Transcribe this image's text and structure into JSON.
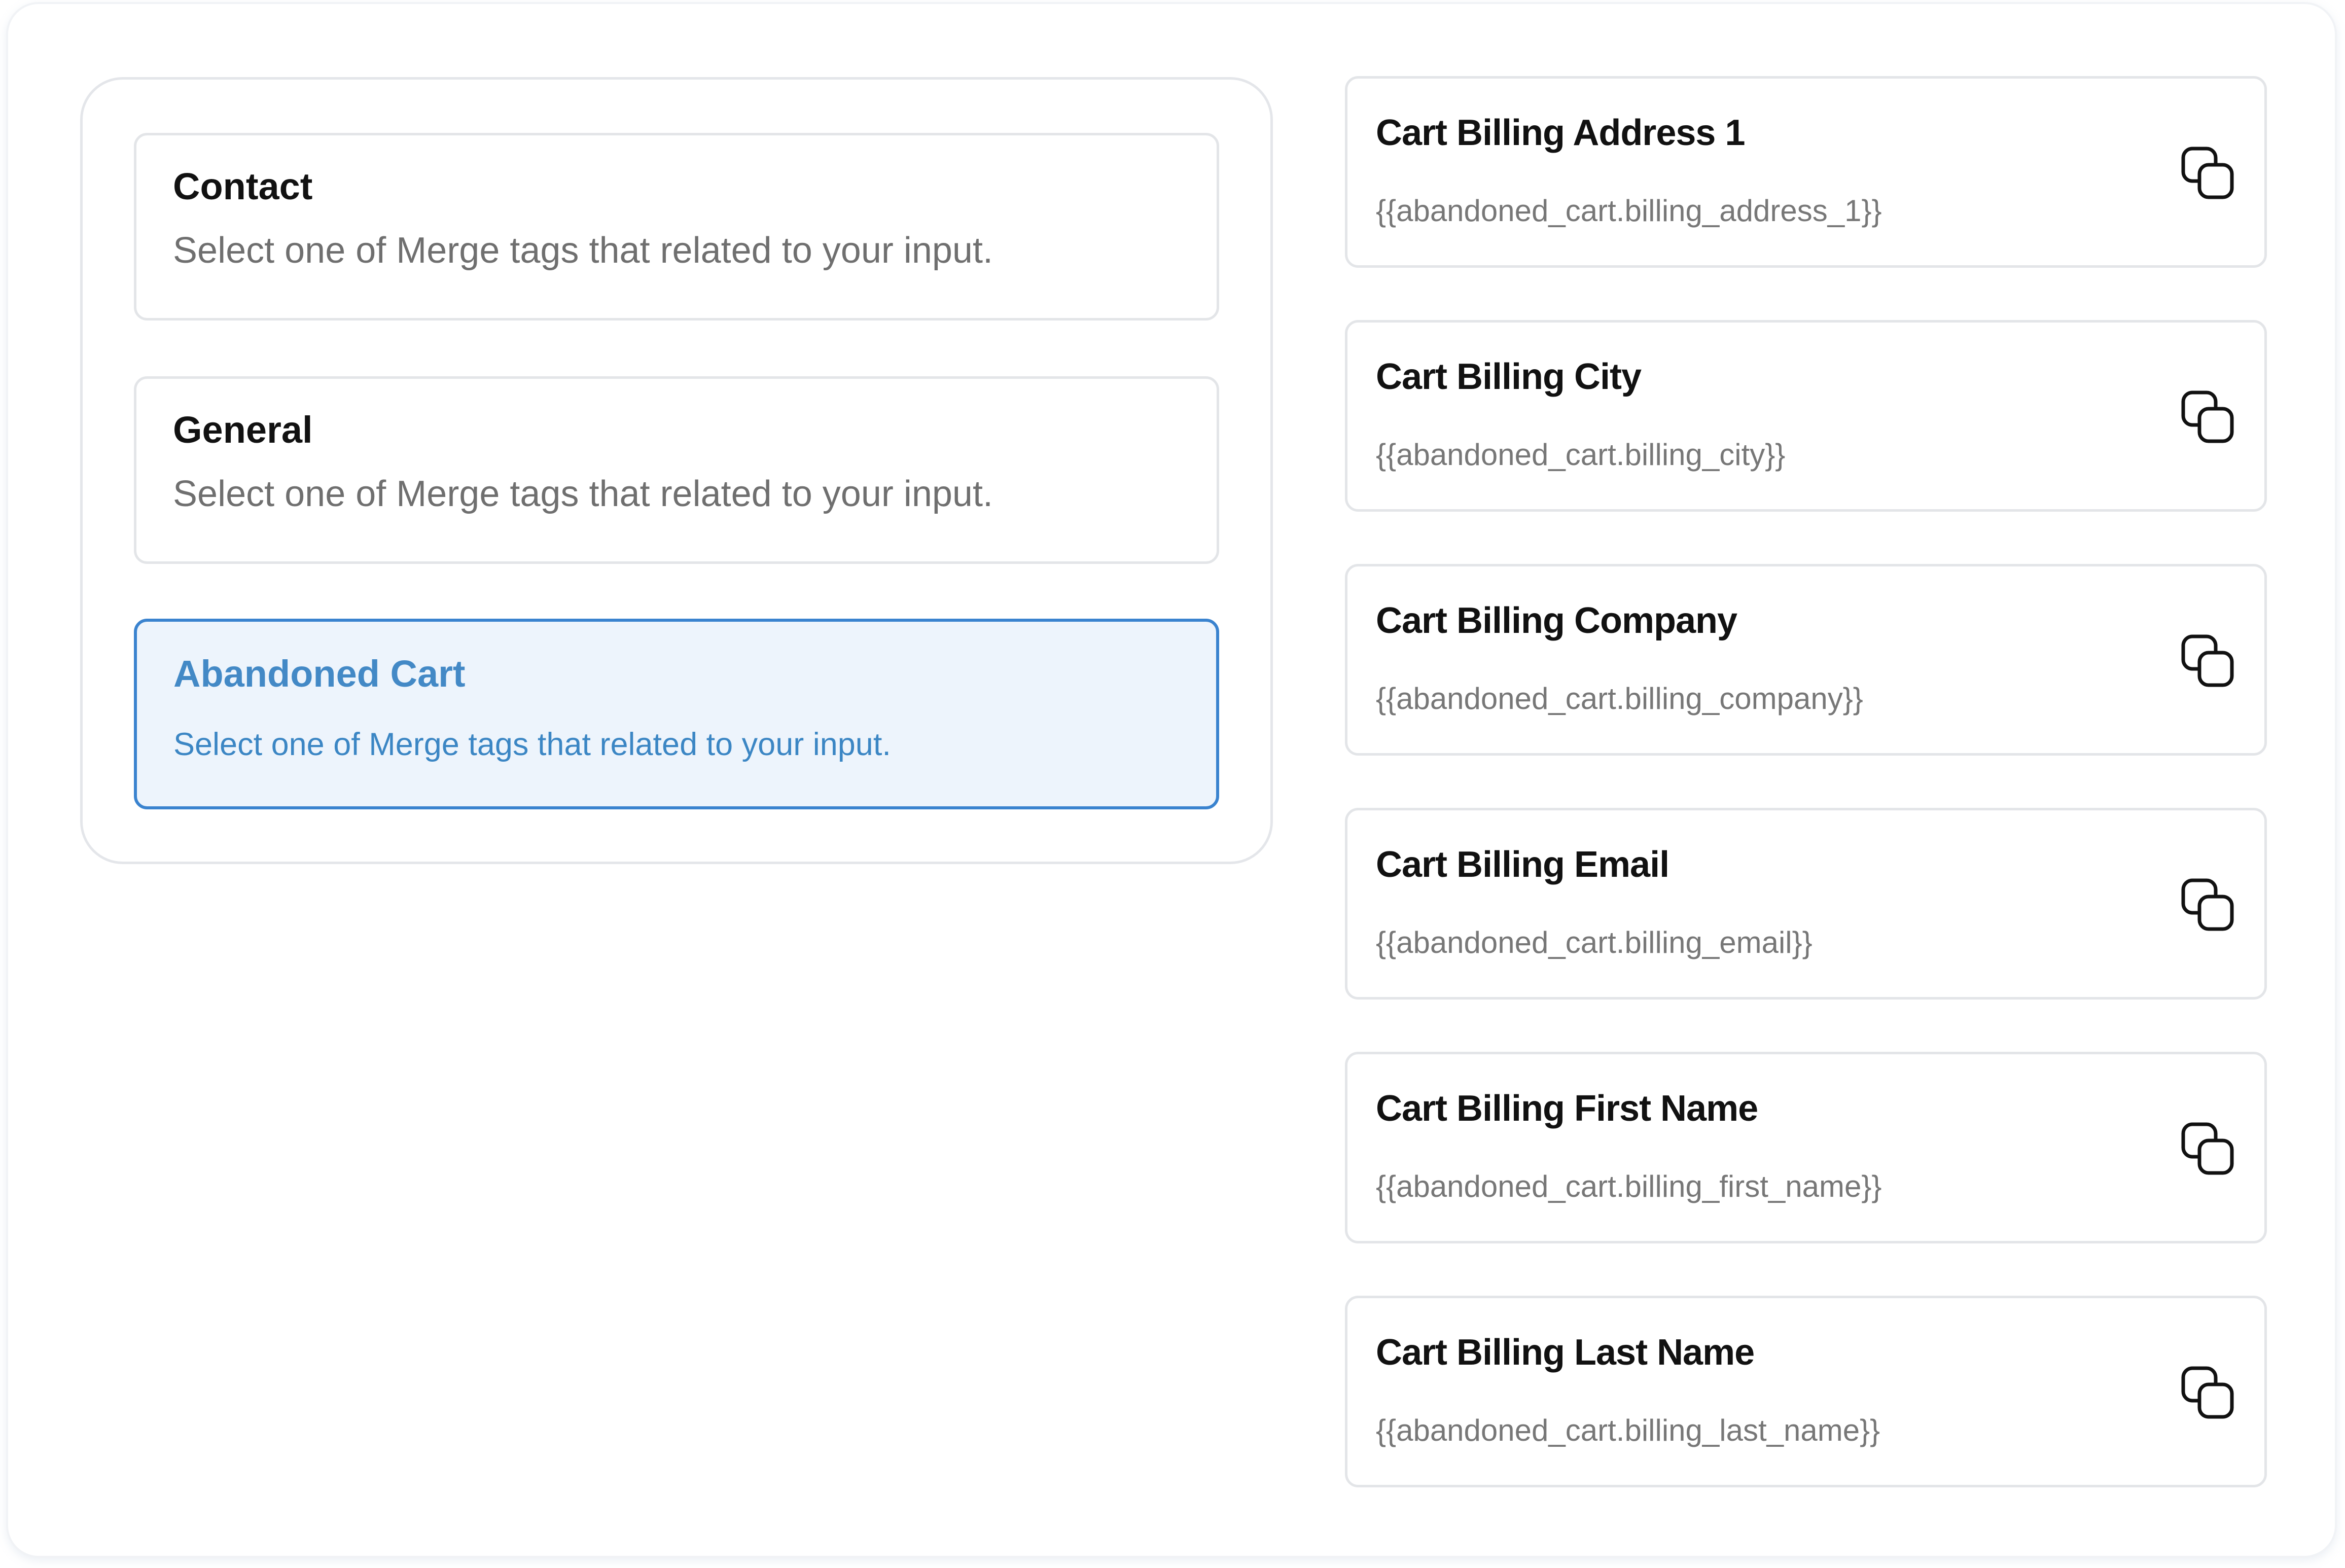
{
  "categories": [
    {
      "title": "Contact",
      "description": "Select one of Merge tags that related to your input.",
      "active": false
    },
    {
      "title": "General",
      "description": "Select one of Merge tags that related to your input.",
      "active": false
    },
    {
      "title": "Abandoned Cart",
      "description": "Select one of Merge tags that related to your input.",
      "active": true
    }
  ],
  "merge_tags": [
    {
      "title": "Cart Billing Address 1",
      "tag": "{{abandoned_cart.billing_address_1}}",
      "icon": "copy-icon"
    },
    {
      "title": "Cart Billing City",
      "tag": "{{abandoned_cart.billing_city}}",
      "icon": "copy-icon"
    },
    {
      "title": "Cart Billing Company",
      "tag": "{{abandoned_cart.billing_company}}",
      "icon": "copy-icon"
    },
    {
      "title": "Cart Billing Email",
      "tag": "{{abandoned_cart.billing_email}}",
      "icon": "copy-icon"
    },
    {
      "title": "Cart Billing First Name",
      "tag": "{{abandoned_cart.billing_first_name}}",
      "icon": "copy-icon"
    },
    {
      "title": "Cart Billing Last Name",
      "tag": "{{abandoned_cart.billing_last_name}}",
      "icon": "copy-icon"
    }
  ],
  "colors": {
    "accent": "#3a83cf",
    "active_background": "#edf4fc",
    "text_primary": "#111111",
    "text_muted": "#6f6f6f",
    "border": "#e3e5e8"
  }
}
